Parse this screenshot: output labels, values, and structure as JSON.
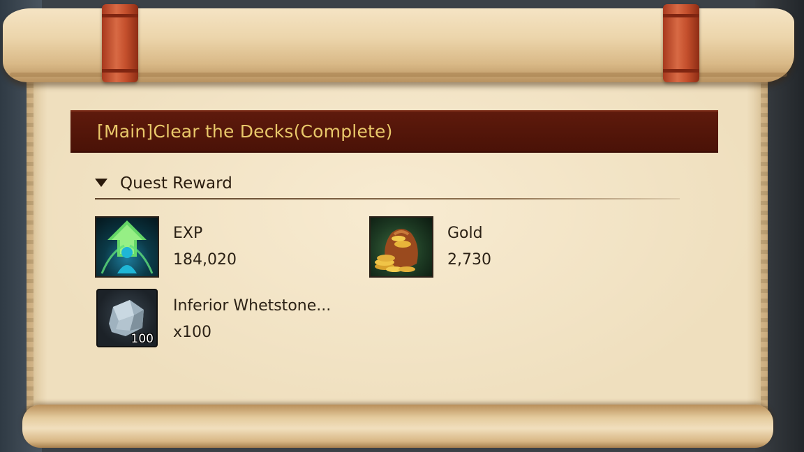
{
  "quest": {
    "title": "[Main]Clear the Decks(Complete)"
  },
  "rewards_section": {
    "label": "Quest Reward",
    "icon": "caret-down-icon"
  },
  "rewards": [
    {
      "name": "EXP",
      "value": "184,020",
      "icon": "exp-arrow-icon"
    },
    {
      "name": "Gold",
      "value": "2,730",
      "icon": "gold-bag-icon"
    },
    {
      "name": "Inferior Whetstone...",
      "value": "x100",
      "icon": "whetstone-icon",
      "stack_count": "100"
    }
  ],
  "colors": {
    "title_bar": "#4a1207",
    "title_text": "#e9c86a",
    "parchment": "#f0dfbe",
    "band": "#c5502d"
  }
}
